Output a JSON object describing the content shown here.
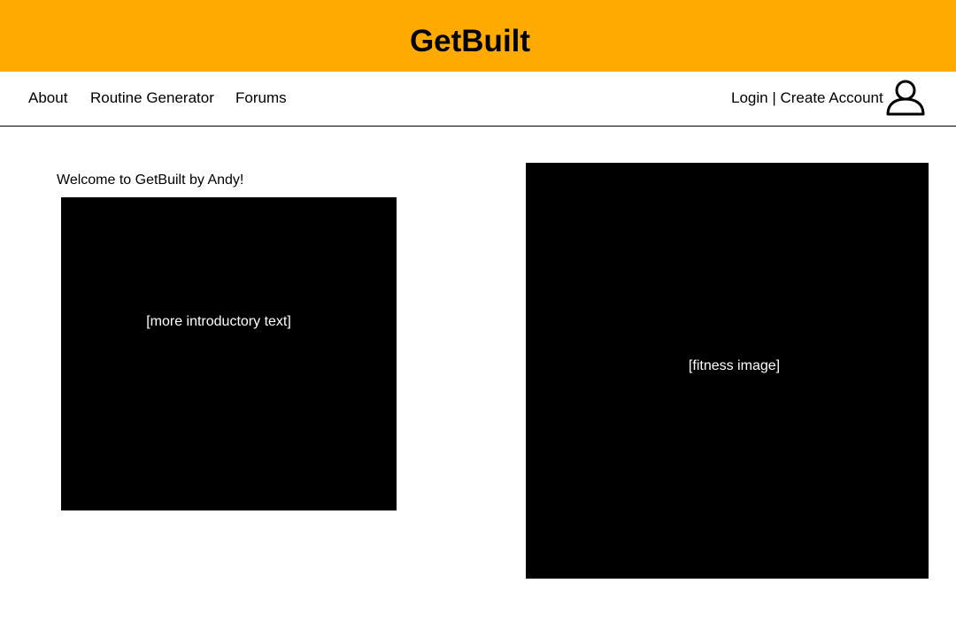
{
  "header": {
    "title": "GetBuilt",
    "background_color": "#ffaa00"
  },
  "nav": {
    "items": [
      {
        "label": "About"
      },
      {
        "label": "Routine Generator"
      },
      {
        "label": "Forums"
      }
    ],
    "login_label": "Login",
    "separator": " | ",
    "create_account_label": "Create Account",
    "avatar_icon": "user-profile-icon"
  },
  "main": {
    "welcome_text": "Welcome to GetBuilt by Andy!",
    "intro_placeholder": "[more introductory text]",
    "image_placeholder": "[fitness image]"
  }
}
